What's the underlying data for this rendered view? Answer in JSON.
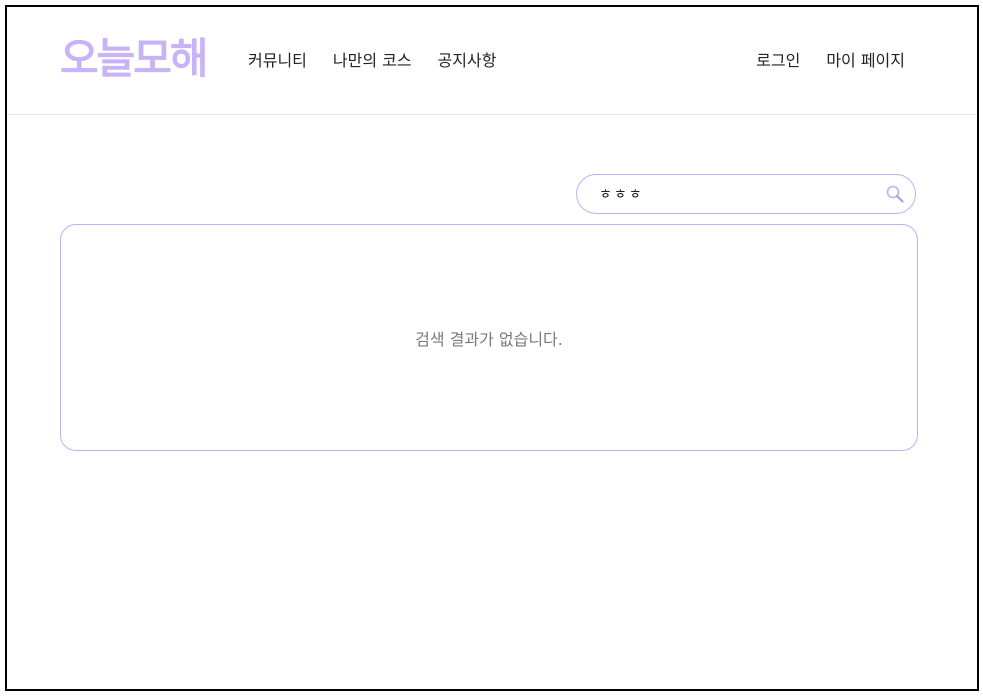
{
  "header": {
    "logo": "오늘모해",
    "nav_left": [
      "커뮤니티",
      "나만의 코스",
      "공지사항"
    ],
    "nav_right": [
      "로그인",
      "마이 페이지"
    ]
  },
  "search": {
    "value": "ㅎㅎㅎ",
    "icon": "search-icon"
  },
  "results": {
    "empty_message": "검색 결과가 없습니다."
  },
  "colors": {
    "accent": "#c4aef5",
    "logo": "#c9b3f7"
  }
}
